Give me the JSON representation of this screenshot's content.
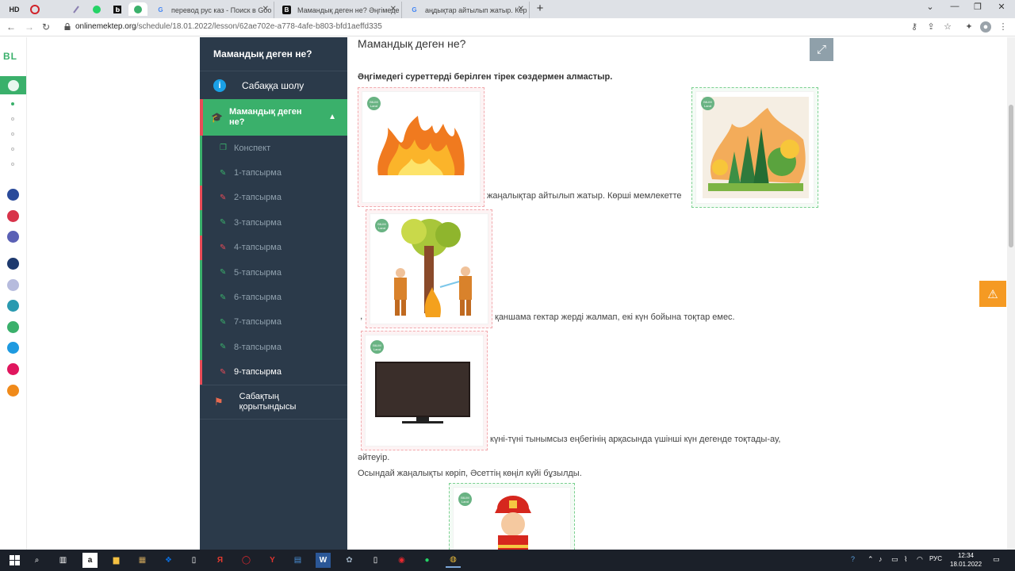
{
  "browser": {
    "pinned": [
      "HD",
      "",
      "",
      "",
      "",
      "",
      ""
    ],
    "tabs": [
      {
        "title": "перевод рус каз - Поиск в Goo",
        "favicon": "G"
      },
      {
        "title": "Мамандық деген не? Әңгімеде",
        "favicon": "B"
      },
      {
        "title": "аңдықтар айтылып жатыр. Кер",
        "favicon": "G"
      }
    ],
    "url_main": "onlinemektep.org",
    "url_path": "/schedule/18.01.2022/lesson/62ae702e-a778-4afe-b803-bfd1aeffd335"
  },
  "rail": {
    "logo": "BL",
    "apps": [
      {
        "color": "#2a4a9a"
      },
      {
        "color": "#d8334a"
      },
      {
        "color": "#5a60b5"
      },
      {
        "color": "#1e3a6e"
      },
      {
        "color": "#b6bbdd"
      },
      {
        "color": "#2a9ab0"
      },
      {
        "color": "#3ab06b"
      },
      {
        "color": "#1e9ae0"
      },
      {
        "color": "#e0165e"
      },
      {
        "color": "#f08a1a"
      }
    ]
  },
  "sidebar": {
    "title": "Мамандық деген не?",
    "overview": "Сабаққа шолу",
    "active_lesson": "Мамандық деген не?",
    "items": [
      {
        "label": "Конспект",
        "icon": "book-icon",
        "color": "green"
      },
      {
        "label": "1-тапсырма",
        "icon": "edit-icon",
        "color": "green"
      },
      {
        "label": "2-тапсырма",
        "icon": "edit-icon",
        "color": "red"
      },
      {
        "label": "3-тапсырма",
        "icon": "edit-icon",
        "color": "green"
      },
      {
        "label": "4-тапсырма",
        "icon": "edit-icon",
        "color": "red"
      },
      {
        "label": "5-тапсырма",
        "icon": "edit-icon",
        "color": "green"
      },
      {
        "label": "6-тапсырма",
        "icon": "edit-icon",
        "color": "green"
      },
      {
        "label": "7-тапсырма",
        "icon": "edit-icon",
        "color": "green"
      },
      {
        "label": "8-тапсырма",
        "icon": "edit-icon",
        "color": "green"
      },
      {
        "label": "9-тапсырма",
        "icon": "edit-icon",
        "color": "red"
      }
    ],
    "final": "Сабақтың қорытындысы"
  },
  "main": {
    "title": "Мамандық деген не?",
    "instruction": "Әңгімедегі суреттерді берілген тірек сөздермен алмастыр.",
    "badge_text": "BILIM Land",
    "text1": "жаңалықтар айтылып жатыр. Көрші мемлекетте",
    "text2_pre": ",",
    "text2": "қаншама гектар жерді жалмап, екі күн бойына тоқтар емес.",
    "text3": "күні-түні тынымсыз еңбегінің арқасында үшінші күн дегенде тоқтады-ау,",
    "text4": "әйтеуір.",
    "text5": "Осындай жаңалықты көріп, Әсеттің көңіл күйі бұзылды."
  },
  "taskbar": {
    "lang": "РУС",
    "time": "12:34",
    "date": "18.01.2022"
  }
}
